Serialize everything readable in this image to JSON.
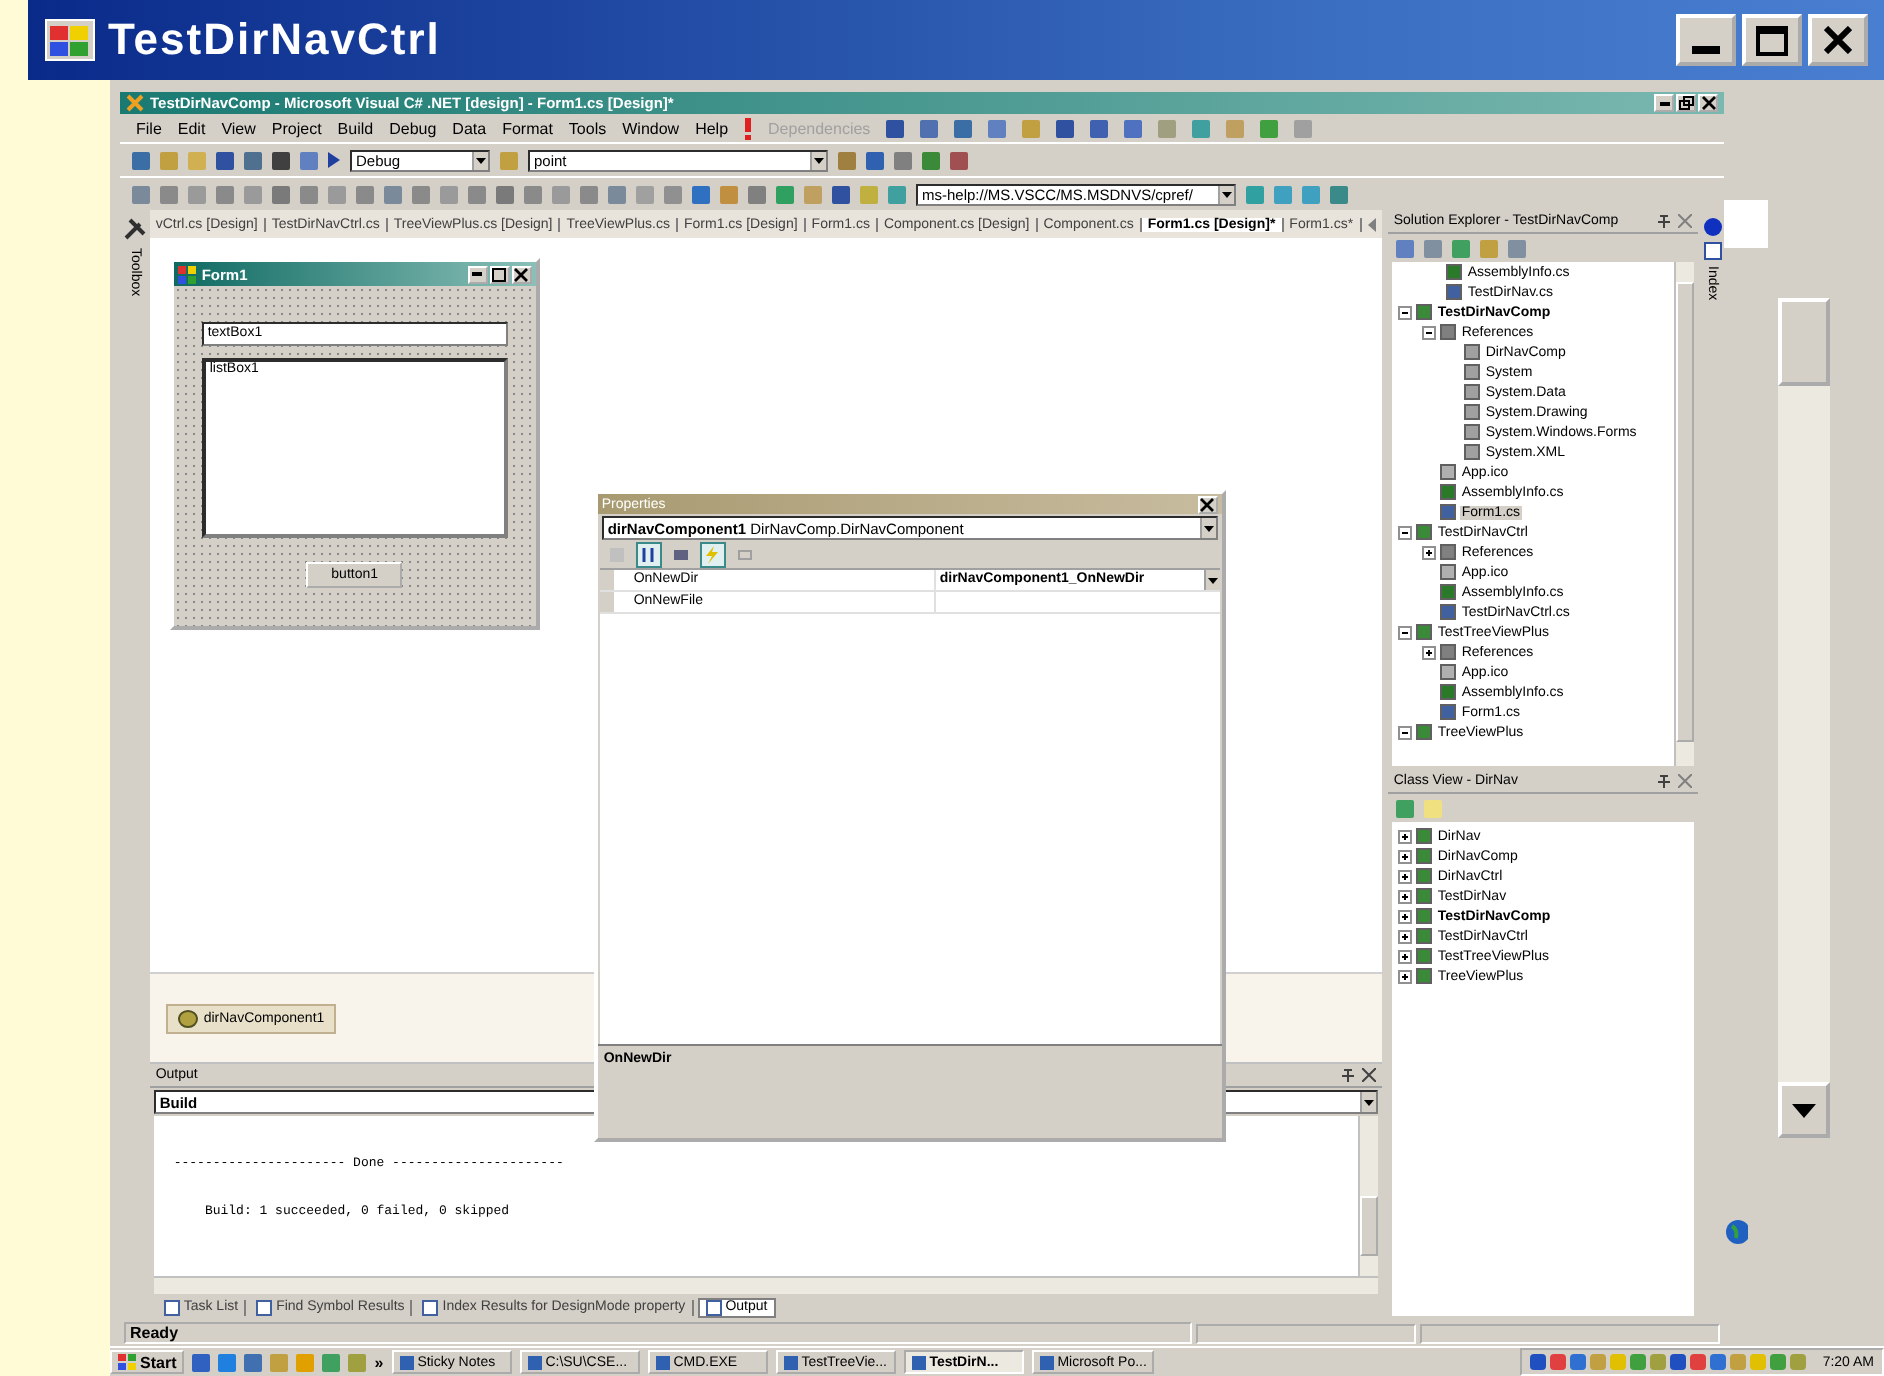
{
  "outer_window": {
    "title": "TestDirNavCtrl"
  },
  "ide": {
    "title": "TestDirNavComp - Microsoft Visual C# .NET [design] - Form1.cs [Design]*"
  },
  "menu": [
    {
      "label": "File",
      "disabled": false
    },
    {
      "label": "Edit",
      "disabled": false
    },
    {
      "label": "View",
      "disabled": false
    },
    {
      "label": "Project",
      "disabled": false
    },
    {
      "label": "Build",
      "disabled": false
    },
    {
      "label": "Debug",
      "disabled": false
    },
    {
      "label": "Data",
      "disabled": false
    },
    {
      "label": "Format",
      "disabled": false
    },
    {
      "label": "Tools",
      "disabled": false
    },
    {
      "label": "Window",
      "disabled": false
    },
    {
      "label": "Help",
      "disabled": false
    },
    {
      "label": "Dependencies",
      "disabled": true
    }
  ],
  "toolbar": {
    "configuration": "Debug",
    "find": "point",
    "help_url": "ms-help://MS.VSCC/MS.MSDNVS/cpref/"
  },
  "toolbox_label": "Toolbox",
  "document_tabs": [
    {
      "label": "vCtrl.cs [Design]",
      "selected": false
    },
    {
      "label": "TestDirNavCtrl.cs",
      "selected": false
    },
    {
      "label": "TreeViewPlus.cs [Design]",
      "selected": false
    },
    {
      "label": "TreeViewPlus.cs",
      "selected": false
    },
    {
      "label": "Form1.cs [Design]",
      "selected": false
    },
    {
      "label": "Form1.cs",
      "selected": false
    },
    {
      "label": "Component.cs [Design]",
      "selected": false
    },
    {
      "label": "Component.cs",
      "selected": false
    },
    {
      "label": "Form1.cs [Design]*",
      "selected": true
    },
    {
      "label": "Form1.cs*",
      "selected": false
    }
  ],
  "form_designer": {
    "title": "Form1",
    "textbox": "textBox1",
    "listbox": "listBox1",
    "button": "button1"
  },
  "component_tray": [
    "dirNavComponent1"
  ],
  "properties": {
    "title": "Properties",
    "object_name": "dirNavComponent1",
    "object_type": "DirNavComp.DirNavComponent",
    "view_buttons": [
      {
        "kind": "categorized",
        "selected": false
      },
      {
        "kind": "alphabetical",
        "selected": true
      },
      {
        "kind": "properties",
        "selected": false
      },
      {
        "kind": "events",
        "selected": true
      },
      {
        "kind": "pages",
        "selected": false
      }
    ],
    "rows": [
      {
        "name": "OnNewDir",
        "value": "dirNavComponent1_OnNewDir"
      },
      {
        "name": "OnNewFile"
      }
    ],
    "description_title": "OnNewDir"
  },
  "output": {
    "title": "Output",
    "source": "Build",
    "lines": [
      "---------------------- Done ----------------------",
      "    Build: 1 succeeded, 0 failed, 0 skipped"
    ]
  },
  "bottom_tabs": [
    {
      "label": "Task List",
      "selected": false
    },
    {
      "label": "Find Symbol Results",
      "selected": false
    },
    {
      "label": "Index Results for DesignMode property",
      "selected": false
    },
    {
      "label": "Output",
      "selected": true
    }
  ],
  "solution_explorer": {
    "title": "Solution Explorer - TestDirNavComp",
    "continued_items": [
      {
        "label": "AssemblyInfo.cs",
        "kind": "code"
      },
      {
        "label": "TestDirNav.cs",
        "kind": "form"
      }
    ],
    "tree": [
      {
        "label": "TestDirNavComp",
        "kind": "project",
        "bold": true,
        "expanded": true,
        "selected": false,
        "children": [
          {
            "label": "References",
            "kind": "references",
            "bold": false,
            "expanded": true,
            "selected": false,
            "children": [
              {
                "label": "DirNavComp",
                "kind": "reference",
                "bold": false,
                "selected": false
              },
              {
                "label": "System",
                "kind": "reference",
                "bold": false,
                "selected": false
              },
              {
                "label": "System.Data",
                "kind": "reference",
                "bold": false,
                "selected": false
              },
              {
                "label": "System.Drawing",
                "kind": "reference",
                "bold": false,
                "selected": false
              },
              {
                "label": "System.Windows.Forms",
                "kind": "reference",
                "bold": false,
                "selected": false
              },
              {
                "label": "System.XML",
                "kind": "reference",
                "bold": false,
                "selected": false
              }
            ]
          },
          {
            "label": "App.ico",
            "kind": "ico",
            "bold": false,
            "selected": false
          },
          {
            "label": "AssemblyInfo.cs",
            "kind": "code",
            "bold": false,
            "selected": false
          },
          {
            "label": "Form1.cs",
            "kind": "form",
            "bold": false,
            "selected": true
          }
        ]
      },
      {
        "label": "TestDirNavCtrl",
        "kind": "project",
        "bold": false,
        "expanded": true,
        "selected": false,
        "children": [
          {
            "label": "References",
            "kind": "references",
            "bold": false,
            "expanded": false,
            "selected": false
          },
          {
            "label": "App.ico",
            "kind": "ico",
            "bold": false,
            "selected": false
          },
          {
            "label": "AssemblyInfo.cs",
            "kind": "code",
            "bold": false,
            "selected": false
          },
          {
            "label": "TestDirNavCtrl.cs",
            "kind": "form",
            "bold": false,
            "selected": false
          }
        ]
      },
      {
        "label": "TestTreeViewPlus",
        "kind": "project",
        "bold": false,
        "expanded": true,
        "selected": false,
        "children": [
          {
            "label": "References",
            "kind": "references",
            "bold": false,
            "expanded": false,
            "selected": false
          },
          {
            "label": "App.ico",
            "kind": "ico",
            "bold": false,
            "selected": false
          },
          {
            "label": "AssemblyInfo.cs",
            "kind": "code",
            "bold": false,
            "selected": false
          },
          {
            "label": "Form1.cs",
            "kind": "form",
            "bold": false,
            "selected": false
          }
        ]
      },
      {
        "label": "TreeViewPlus",
        "kind": "project",
        "bold": false,
        "expanded": true,
        "selected": false
      }
    ]
  },
  "class_view": {
    "title": "Class View - DirNav",
    "items": [
      {
        "label": "DirNav",
        "bold": false,
        "expanded": false
      },
      {
        "label": "DirNavComp",
        "bold": false,
        "expanded": false
      },
      {
        "label": "DirNavCtrl",
        "bold": false,
        "expanded": false
      },
      {
        "label": "TestDirNav",
        "bold": false,
        "expanded": false
      },
      {
        "label": "TestDirNavComp",
        "bold": true,
        "expanded": false
      },
      {
        "label": "TestDirNavCtrl",
        "bold": false,
        "expanded": false
      },
      {
        "label": "TestTreeViewPlus",
        "bold": false,
        "expanded": false
      },
      {
        "label": "TreeViewPlus",
        "bold": false,
        "expanded": false
      }
    ]
  },
  "side_tab": "Index",
  "status_bar": "Ready",
  "taskbar": {
    "start": "Start",
    "overflow": "»",
    "tasks": [
      {
        "label": "Sticky Notes",
        "selected": false
      },
      {
        "label": "C:\\SU\\CSE...",
        "selected": false
      },
      {
        "label": "CMD.EXE",
        "selected": false
      },
      {
        "label": "TestTreeVie...",
        "selected": false
      },
      {
        "label": "TestDirN...",
        "selected": true
      },
      {
        "label": "Microsoft Po...",
        "selected": false
      }
    ],
    "clock": "7:20 AM"
  }
}
